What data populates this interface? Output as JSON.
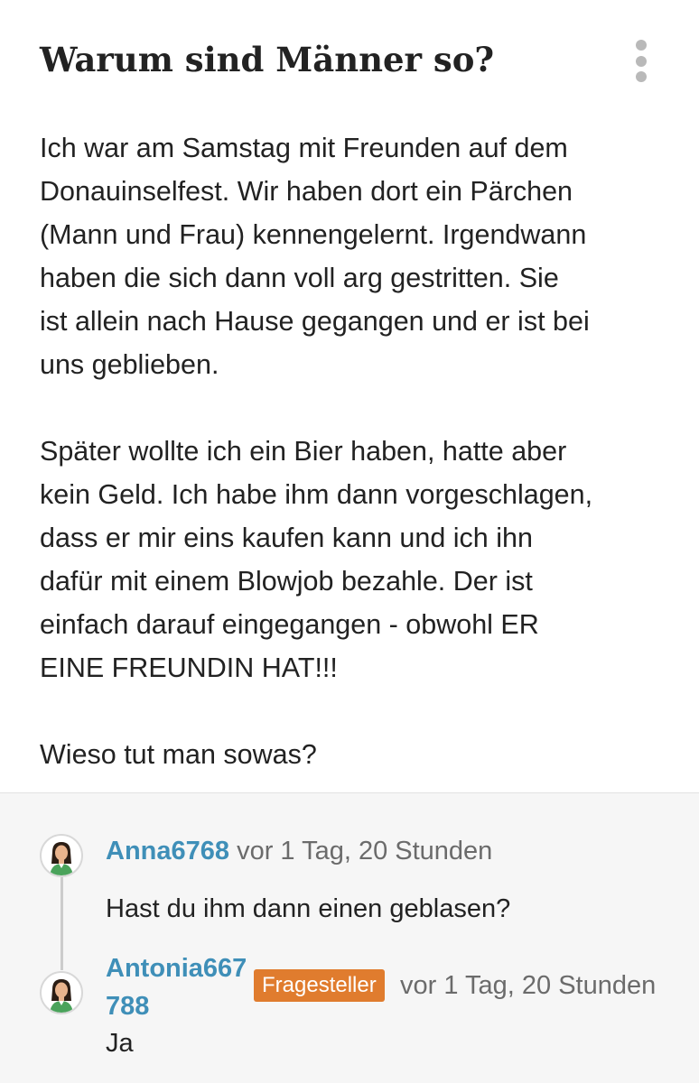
{
  "question": {
    "title": "Warum sind Männer so?",
    "paragraph_1": [
      "Ich war am Samstag mit Freunden auf dem",
      "Donauinselfest. Wir haben dort ein Pärchen",
      "(Mann und Frau) kennengelernt. Irgendwann",
      "haben die sich dann voll arg gestritten. Sie",
      "ist allein nach Hause gegangen und er ist bei",
      "uns geblieben."
    ],
    "paragraph_2": [
      "Später wollte ich ein Bier haben, hatte aber",
      "kein Geld. Ich habe ihm dann vorgeschlagen,",
      "dass er mir eins kaufen kann und ich ihn",
      "dafür mit einem Blowjob bezahle. Der ist",
      "einfach darauf eingegangen - obwohl ER",
      "EINE FREUNDIN HAT!!!"
    ],
    "paragraph_3": "Wieso tut man sowas?",
    "more_icon": "more-vertical-icon"
  },
  "comments": [
    {
      "user": "Anna6768",
      "time": "vor 1 Tag, 20 Stunden",
      "text": "Hast du ihm dann einen geblasen?",
      "avatar_icon": "user-avatar-icon"
    },
    {
      "user_line_1": "Antonia667",
      "user_line_2": "788",
      "badge": "Fragesteller",
      "time": "vor 1 Tag, 20 Stunden",
      "text": "Ja",
      "avatar_icon": "user-avatar-icon"
    }
  ],
  "colors": {
    "text": "#222222",
    "username": "#3f8fb8",
    "meta": "#6b6b6b",
    "badge": "#e07c2e",
    "comments_bg": "#f6f6f6"
  }
}
